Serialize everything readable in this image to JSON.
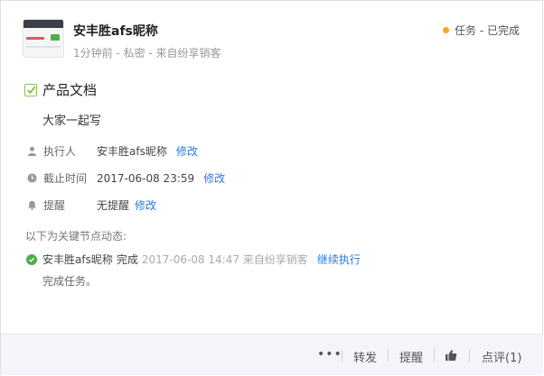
{
  "post": {
    "author": "安丰胜afs昵称",
    "meta": "1分钟前 - 私密 - 来自纷享销客",
    "status": "任务 - 已完成",
    "status_color": "#f5a623"
  },
  "task": {
    "title": "产品文档",
    "description": "大家一起写",
    "fields": [
      {
        "icon": "person-icon",
        "label": "执行人",
        "value": "安丰胜afs昵称",
        "action": "修改"
      },
      {
        "icon": "clock-icon",
        "label": "截止时间",
        "value": "2017-06-08 23:59",
        "action": "修改"
      },
      {
        "icon": "bell-icon",
        "label": "提醒",
        "value": "无提醒",
        "action": "修改"
      }
    ]
  },
  "timeline": {
    "heading": "以下为关键节点动态:",
    "entry": {
      "actor": "安丰胜afs昵称",
      "action": "完成",
      "time": "2017-06-08 14:47 来自纷享销客",
      "link": "继续执行",
      "note": "完成任务。"
    }
  },
  "footer": {
    "more": "•••",
    "forward": "转发",
    "remind": "提醒",
    "comment": "点评(1)"
  },
  "colors": {
    "link": "#2b7bd6",
    "success": "#4caf50",
    "footer_bg": "#f3f5fa"
  }
}
